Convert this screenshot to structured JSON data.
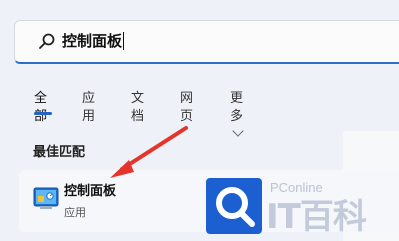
{
  "search": {
    "query": "控制面板"
  },
  "tabs": [
    {
      "label": "全部"
    },
    {
      "label": "应用"
    },
    {
      "label": "文档"
    },
    {
      "label": "网页"
    },
    {
      "label": "更多"
    }
  ],
  "best_match": {
    "title": "最佳匹配",
    "app_name": "控制面板",
    "app_type": "应用",
    "icon": "control-panel-icon"
  },
  "watermark": {
    "brand": "PConline",
    "name": "IT百科"
  },
  "colors": {
    "accent": "#2463c2",
    "arrow": "#e5342b",
    "watermark_blue": "#1b5fd0"
  }
}
